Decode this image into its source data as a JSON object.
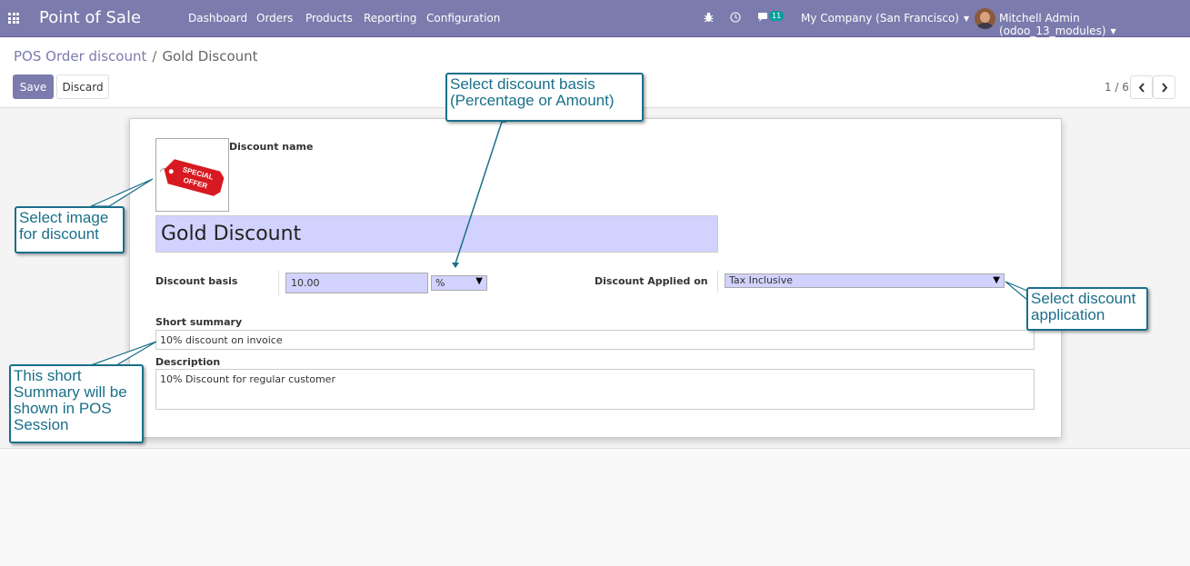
{
  "topbar": {
    "app_title": "Point of Sale",
    "menu": [
      "Dashboard",
      "Orders",
      "Products",
      "Reporting",
      "Configuration"
    ],
    "icons": [
      "bug-icon",
      "clock-icon",
      "chat-icon"
    ],
    "message_count": "11",
    "company": "My Company (San Francisco)",
    "user": "Mitchell Admin (odoo_13_modules)"
  },
  "breadcrumb": {
    "parent": "POS Order discount",
    "separator": "/",
    "current": "Gold Discount"
  },
  "buttons": {
    "save": "Save",
    "discard": "Discard"
  },
  "pager": {
    "value": "1 / 6"
  },
  "form": {
    "discount_name_label": "Discount name",
    "discount_name_value": "Gold Discount",
    "image_text": "SPECIAL OFFER",
    "discount_basis_label": "Discount basis",
    "discount_basis_value": "10.00",
    "discount_basis_type": "%",
    "applied_on_label": "Discount Applied on",
    "applied_on_value": "Tax Inclusive",
    "short_summary_label": "Short summary",
    "short_summary_value": "10% discount on invoice",
    "description_label": "Description",
    "description_value": "10% Discount for regular customer"
  },
  "callouts": {
    "basis": [
      "Select discount basis",
      "(Percentage or Amount)"
    ],
    "image": [
      "Select image",
      "for discount"
    ],
    "application": [
      "Select discount",
      "application"
    ],
    "summary": [
      "This short",
      "Summary will be",
      "shown in POS",
      "Session"
    ]
  },
  "colors": {
    "navbar": "#7c7bad",
    "primary": "#7c7bad",
    "required_field": "#d2d2ff",
    "callout": "#1a6f8a"
  }
}
